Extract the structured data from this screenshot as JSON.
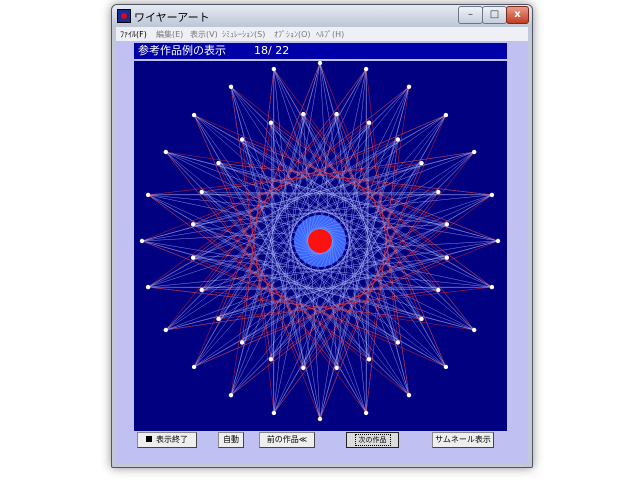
{
  "window": {
    "title": "ワイヤーアート"
  },
  "controls": {
    "minimize": "–",
    "maximize": "□",
    "close": "x"
  },
  "menu": {
    "items": [
      {
        "label": "ﾌｧｲﾙ(F)"
      },
      {
        "label": "編集(E)"
      },
      {
        "label": "表示(V)"
      },
      {
        "label": "ｼﾐｭﾚｰｼｮﾝ(S)"
      },
      {
        "label": "ｵﾌﾟｼｮﾝ(O)"
      },
      {
        "label": "ﾍﾙﾌﾟ(H)"
      }
    ]
  },
  "viewer": {
    "title": "参考作品例の表示",
    "counter": "18/ 22"
  },
  "artwork": {
    "colors": {
      "background": "#000080",
      "line_light": "#aab4ff",
      "line_white": "#ffffff",
      "line_red": "#d02030",
      "core_blue": "#3a66ff",
      "core_red": "#ff1010"
    }
  },
  "buttons": {
    "end_display": "表示終了",
    "auto": "自動",
    "previous": "前の作品≪",
    "next": "次の作品",
    "thumbnails": "サムネール表示"
  }
}
